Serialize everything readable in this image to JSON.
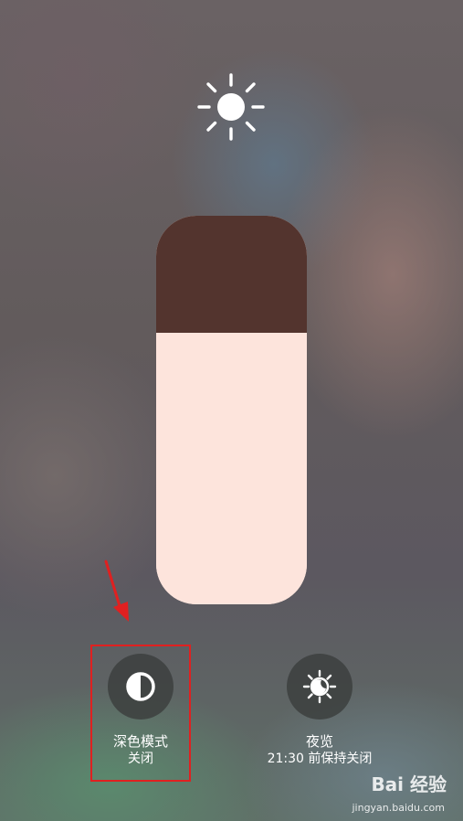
{
  "brightness": {
    "level": 0.7
  },
  "controls": {
    "dark_mode": {
      "label": "深色模式",
      "status": "关闭"
    },
    "night_shift": {
      "label": "夜览",
      "status": "21:30 前保持关闭"
    }
  },
  "watermark": {
    "brand": "Bai 经验",
    "site": "jingyan.baidu.com"
  },
  "colors": {
    "slider_fill": "#fde4dc",
    "slider_empty": "#53342e",
    "highlight": "#e02020"
  },
  "icons": {
    "top": "sun-icon",
    "dark_mode": "half-circle-icon",
    "night_shift": "sun-moon-icon"
  }
}
